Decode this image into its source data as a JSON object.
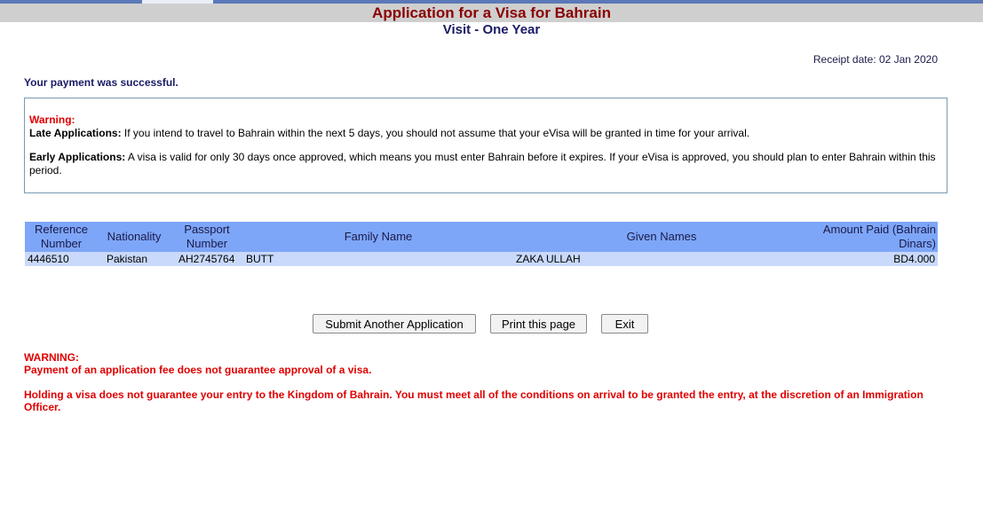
{
  "header": {
    "title": "Application for a Visa for Bahrain",
    "subtitle": "Visit - One Year"
  },
  "receipt": {
    "label": "Receipt date:",
    "date": "02 Jan 2020"
  },
  "payment_message": "Your payment was successful.",
  "warning_box": {
    "heading": "Warning:",
    "late_label": "Late Applications:",
    "late_text": " If you intend to travel to Bahrain within the next 5 days, you should not assume that your eVisa will be granted in time for your arrival.",
    "early_label": "Early Applications:",
    "early_text": " A visa is valid for only 30 days once approved, which means you must enter Bahrain before it expires. If your eVisa is approved, you should plan to enter Bahrain within this period."
  },
  "table": {
    "headers": {
      "reference": "Reference Number",
      "nationality": "Nationality",
      "passport": "Passport Number",
      "family_name": "Family Name",
      "given_names": "Given Names",
      "amount": "Amount Paid (Bahrain Dinars)"
    },
    "row": {
      "reference": "4446510",
      "nationality": "Pakistan",
      "passport": "AH2745764",
      "family_name": "BUTT",
      "given_names": "ZAKA ULLAH",
      "amount": "BD4.000"
    }
  },
  "buttons": {
    "submit_another": "Submit Another Application",
    "print": "Print this page",
    "exit": "Exit"
  },
  "bottom_warning": {
    "heading": "WARNING:",
    "line1": "Payment of an application fee does not guarantee approval of a visa.",
    "line2": "Holding a visa does not guarantee your entry to the Kingdom of Bahrain. You must meet all of the conditions on arrival to be granted the entry, at the discretion of an Immigration Officer."
  },
  "colors": {
    "title": "#8b0000",
    "subtitle": "#1a1a66",
    "warning_red": "#e00000",
    "table_header_bg": "#7ea6f8",
    "table_row_bg": "#c9d9fb",
    "header_bar_bg": "#cfcfcf"
  }
}
